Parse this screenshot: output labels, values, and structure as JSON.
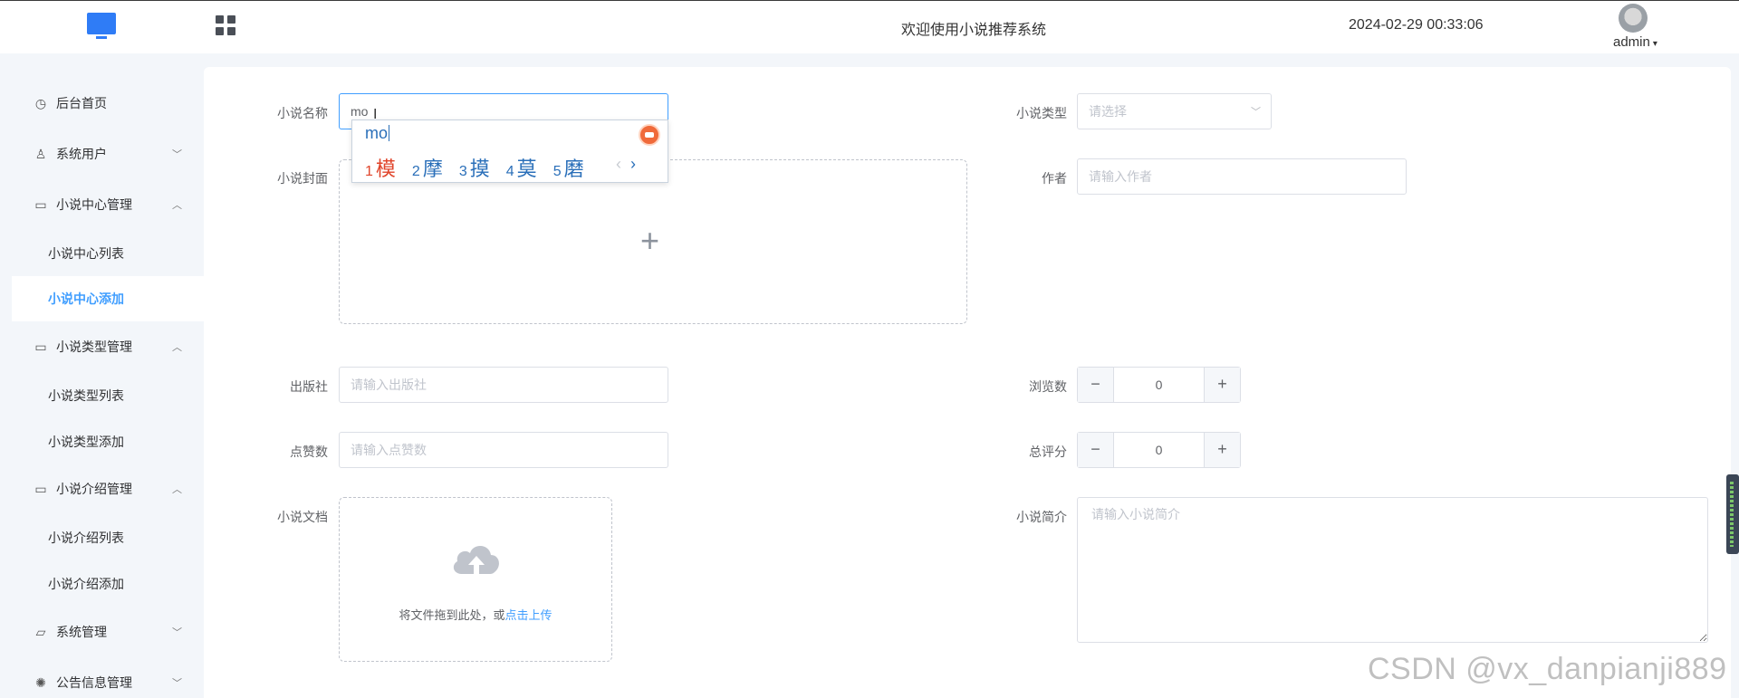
{
  "header": {
    "title": "欢迎使用小说推荐系统",
    "datetime": "2024-02-29 00:33:06",
    "username": "admin",
    "logo_icon": "monitor-icon",
    "menu_icon": "grid-icon"
  },
  "sidebar": {
    "items": [
      {
        "label": "后台首页",
        "icon": "clock-icon",
        "arrow": ""
      },
      {
        "label": "系统用户",
        "icon": "user-icon",
        "arrow": "﹀"
      },
      {
        "label": "小说中心管理",
        "icon": "card-icon",
        "arrow": "︿"
      },
      {
        "label": "小说中心列表",
        "sub": true
      },
      {
        "label": "小说中心添加",
        "sub": true,
        "active": true
      },
      {
        "label": "小说类型管理",
        "icon": "card-icon",
        "arrow": "︿"
      },
      {
        "label": "小说类型列表",
        "sub": true
      },
      {
        "label": "小说类型添加",
        "sub": true
      },
      {
        "label": "小说介绍管理",
        "icon": "card-icon",
        "arrow": "︿"
      },
      {
        "label": "小说介绍列表",
        "sub": true
      },
      {
        "label": "小说介绍添加",
        "sub": true
      },
      {
        "label": "系统管理",
        "icon": "folder-icon",
        "arrow": "﹀"
      },
      {
        "label": "公告信息管理",
        "icon": "spinner-icon",
        "arrow": "﹀"
      }
    ]
  },
  "form": {
    "name_label": "小说名称",
    "name_value": "mo",
    "type_label": "小说类型",
    "type_placeholder": "请选择",
    "cover_label": "小说封面",
    "author_label": "作者",
    "author_placeholder": "请输入作者",
    "publisher_label": "出版社",
    "publisher_placeholder": "请输入出版社",
    "views_label": "浏览数",
    "views_value": "0",
    "likes_label": "点赞数",
    "likes_placeholder": "请输入点赞数",
    "score_label": "总评分",
    "score_value": "0",
    "doc_label": "小说文档",
    "upload_text": "将文件拖到此处，或",
    "upload_link": "点击上传",
    "intro_label": "小说简介",
    "intro_placeholder": "请输入小说简介",
    "stepper_minus": "−",
    "stepper_plus": "+",
    "cover_plus": "+"
  },
  "ime": {
    "pinyin": "mo",
    "candidates": [
      {
        "n": "1",
        "c": "模"
      },
      {
        "n": "2",
        "c": "摩"
      },
      {
        "n": "3",
        "c": "摸"
      },
      {
        "n": "4",
        "c": "莫"
      },
      {
        "n": "5",
        "c": "磨"
      }
    ],
    "prev": "‹",
    "next": "›"
  },
  "watermark": "CSDN @vx_danpianji889",
  "colors": {
    "accent": "#409eff",
    "logo": "#2f7cf6",
    "ime_first": "#e0452b",
    "ime_text": "#2a6fb9"
  }
}
